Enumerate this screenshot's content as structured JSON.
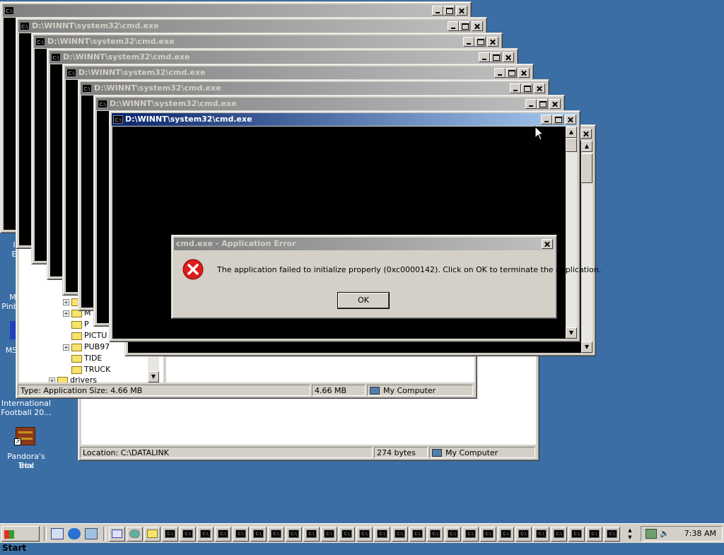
{
  "desktop": {
    "icons": [
      {
        "label_lines": [
          "I",
          "E"
        ],
        "name": "ie-partial"
      },
      {
        "label_lines": [
          "M",
          "Pinb"
        ],
        "name": "pinball-partial"
      },
      {
        "label_lines": [
          "MS"
        ],
        "name": "ms-partial"
      },
      {
        "label_lines": [
          "International",
          "Football 20..."
        ],
        "name": "international-football"
      },
      {
        "label_lines": [
          "Pandora's Box",
          "Trial"
        ],
        "name": "pandoras-box-trial"
      }
    ]
  },
  "console_windows": {
    "icon_glyph": "C:\\",
    "title": "D:\\WINNT\\system32\\cmd.exe",
    "active_title": "D:\\WINNT\\system32\\cmd.exe"
  },
  "explorer_back": {
    "status_location": "Location: C:\\DATALINK",
    "status_size": "274 bytes",
    "status_computer": "My Computer"
  },
  "explorer_front": {
    "tree_items": [
      "P",
      "PICTU",
      "PUB97",
      "TIDE",
      "TRUCK",
      "drivers"
    ],
    "partial_item": "M",
    "status_type": "Type: Application Size: 4.66 MB",
    "status_size": "4.66 MB",
    "status_computer": "My Computer"
  },
  "error_dialog": {
    "title": "cmd.exe - Application Error",
    "message": "The application failed to initialize properly (0xc0000142). Click on OK to terminate the application.",
    "ok_label": "OK",
    "colors": {
      "error_icon": "#e01b1b"
    }
  },
  "taskbar": {
    "start_label": "Start",
    "clock": "7:38 AM",
    "task_glyph": "C:\\"
  },
  "colors": {
    "desktop": "#3a6ea5",
    "active_title": "#0a246a",
    "inactive_title": "#808080"
  }
}
